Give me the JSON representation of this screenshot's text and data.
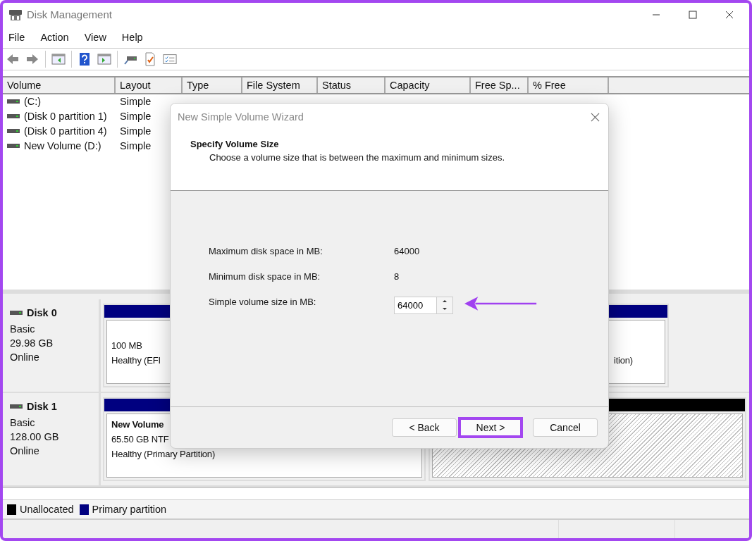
{
  "window": {
    "title": "Disk Management"
  },
  "menu": [
    "File",
    "Action",
    "View",
    "Help"
  ],
  "table": {
    "columns": [
      "Volume",
      "Layout",
      "Type",
      "File System",
      "Status",
      "Capacity",
      "Free Sp...",
      "% Free"
    ],
    "rows": [
      {
        "cells": [
          "(C:)",
          "Simple"
        ]
      },
      {
        "cells": [
          "(Disk 0 partition 1)",
          "Simple"
        ]
      },
      {
        "cells": [
          "(Disk 0 partition 4)",
          "Simple"
        ]
      },
      {
        "cells": [
          "New Volume (D:)",
          "Simple"
        ]
      }
    ]
  },
  "disks": [
    {
      "name": "Disk 0",
      "lines": [
        "Basic",
        "29.98 GB",
        "Online"
      ],
      "partitions": [
        {
          "kind": "primary",
          "lines": [
            "100 MB",
            "Healthy (EFI"
          ]
        },
        {
          "kind": "primary",
          "lines": [
            "ition)"
          ]
        }
      ]
    },
    {
      "name": "Disk 1",
      "lines": [
        "Basic",
        "128.00 GB",
        "Online"
      ],
      "partitions": [
        {
          "kind": "primary",
          "name": "New Volume",
          "lines": [
            "65.50 GB NTF",
            "Healthy (Primary Partition)"
          ]
        },
        {
          "kind": "unallocated"
        }
      ]
    }
  ],
  "legend": [
    {
      "label": "Unallocated",
      "color": "#000000"
    },
    {
      "label": "Primary partition",
      "color": "#000080"
    }
  ],
  "dialog": {
    "title": "New Simple Volume Wizard",
    "heading": "Specify Volume Size",
    "subheading": "Choose a volume size that is between the maximum and minimum sizes.",
    "fields": [
      {
        "kind": "text",
        "label": "Maximum disk space in MB:",
        "value": "64000"
      },
      {
        "kind": "text",
        "label": "Minimum disk space in MB:",
        "value": "8"
      },
      {
        "kind": "spinner",
        "label": "Simple volume size in MB:",
        "value": "64000"
      }
    ],
    "buttons": [
      {
        "label": "< Back",
        "highlighted": false
      },
      {
        "label": "Next >",
        "highlighted": true
      },
      {
        "label": "Cancel",
        "highlighted": false
      }
    ]
  }
}
